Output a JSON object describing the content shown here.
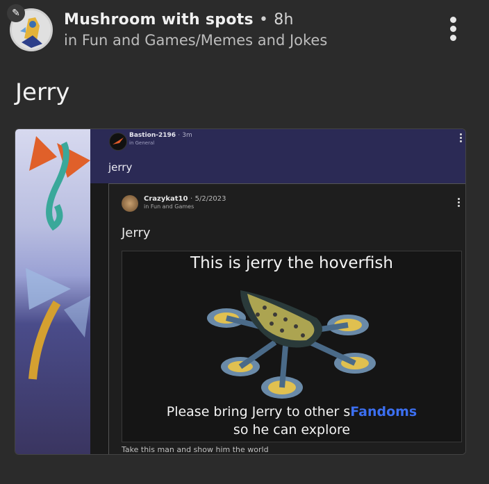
{
  "post": {
    "username": "Mushroom with spots",
    "separator": "•",
    "time": "8h",
    "community": "in Fun and Games/Memes and Jokes",
    "title": "Jerry"
  },
  "embed": {
    "author": "Bastion-2196",
    "separator": "·",
    "time": "3m",
    "community": "in General",
    "title": "jerry",
    "repost": {
      "author": "Crazykat10",
      "separator": "·",
      "date": "5/2/2023",
      "community": "in Fun and Games",
      "title": "Jerry",
      "meme": {
        "top_text": "This is jerry the hoverfish",
        "bottom_line1_start": "Please bring Jerry to other s",
        "bottom_line1_highlight": "Fandoms",
        "bottom_line2": "so he can explore"
      },
      "caption": "Take this man and show him the world"
    }
  },
  "icons": {
    "edit": "pencil-icon",
    "menu": "more-vertical-icon"
  },
  "colors": {
    "background": "#2b2b2b",
    "inner_header": "#2b2a55",
    "highlight": "#3c6ff0"
  }
}
